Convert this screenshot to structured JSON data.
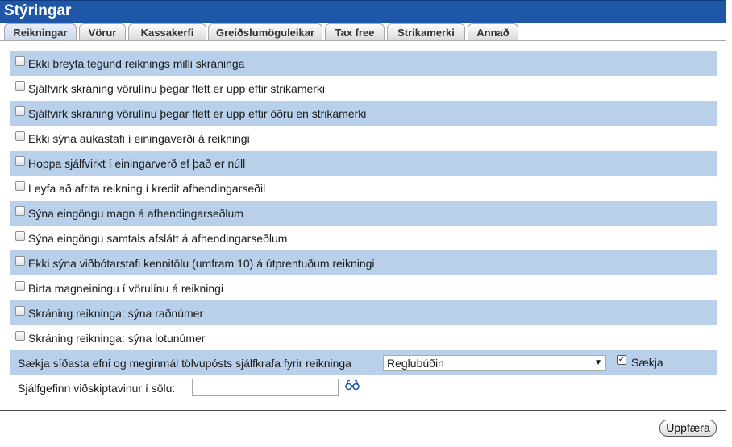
{
  "window": {
    "title": "Stýringar"
  },
  "tabs": [
    {
      "label": "Reikningar",
      "active": true
    },
    {
      "label": "Vörur"
    },
    {
      "label": "Kassakerfi"
    },
    {
      "label": "Greiðslumöguleikar"
    },
    {
      "label": "Tax free"
    },
    {
      "label": "Strikamerki"
    },
    {
      "label": "Annað"
    }
  ],
  "options": [
    {
      "label": "Ekki breyta tegund reiknings milli skráninga",
      "checked": false
    },
    {
      "label": "Sjálfvirk skráning vörulínu þegar flett er upp eftir strikamerki",
      "checked": false
    },
    {
      "label": "Sjálfvirk skráning vörulínu þegar flett er upp eftir öðru en strikamerki",
      "checked": false
    },
    {
      "label": "Ekki sýna aukastafi í einingaverði á reikningi",
      "checked": false
    },
    {
      "label": "Hoppa sjálfvirkt í einingarverð ef það er núll",
      "checked": false
    },
    {
      "label": "Leyfa að afrita reikning í kredit afhendingarseðil",
      "checked": false
    },
    {
      "label": "Sýna eingöngu magn á afhendingarseðlum",
      "checked": false
    },
    {
      "label": "Sýna eingöngu samtals afslátt á afhendingarseðlum",
      "checked": false
    },
    {
      "label": "Ekki sýna viðbótarstafi kennitölu (umfram 10) á útprentuðum reikningi",
      "checked": false
    },
    {
      "label": "Birta magneiningu í vörulínu á reikningi",
      "checked": false
    },
    {
      "label": "Skráning reikninga: sýna raðnúmer",
      "checked": false
    },
    {
      "label": "Skráning reikninga: sýna lotunúmer",
      "checked": false
    }
  ],
  "fetch": {
    "label": "Sækja síðasta efni og meginmál tölvupósts sjálfkrafa fyrir reikninga",
    "select_value": "Reglubúðin",
    "arrow": "▼",
    "checkbox_mark": "✓",
    "checkbox_checked": true,
    "checkbox_label": "Sækja"
  },
  "default_customer": {
    "label": "Sjálfgefinn viðskiptavinur í sölu:",
    "value": "",
    "icon": "glasses-icon"
  },
  "footer": {
    "update_label": "Uppfæra"
  },
  "colors": {
    "titlebar": "#1f57a8",
    "row_blue": "#b8d0ea"
  }
}
